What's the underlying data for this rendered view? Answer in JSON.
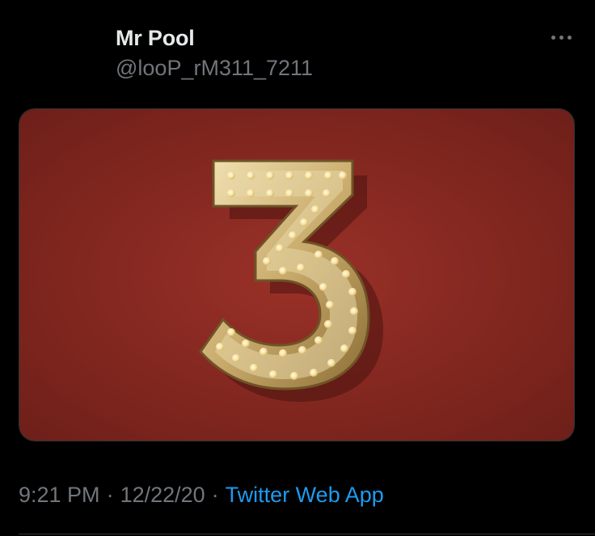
{
  "tweet": {
    "display_name": "Mr Pool",
    "handle": "@looP_rM311_7211",
    "time": "9:21 PM",
    "date": "12/22/20",
    "separator": "·",
    "source": "Twitter Web App",
    "more_icon": "more-horizontal-icon",
    "media": {
      "description_icon": "marquee-number-three-image",
      "background_color": "#8e2b22",
      "figure_color": "#d9c48f"
    }
  },
  "colors": {
    "background": "#000000",
    "primary_text": "#e7e9ea",
    "secondary_text": "#71767b",
    "link": "#1d9bf0"
  }
}
